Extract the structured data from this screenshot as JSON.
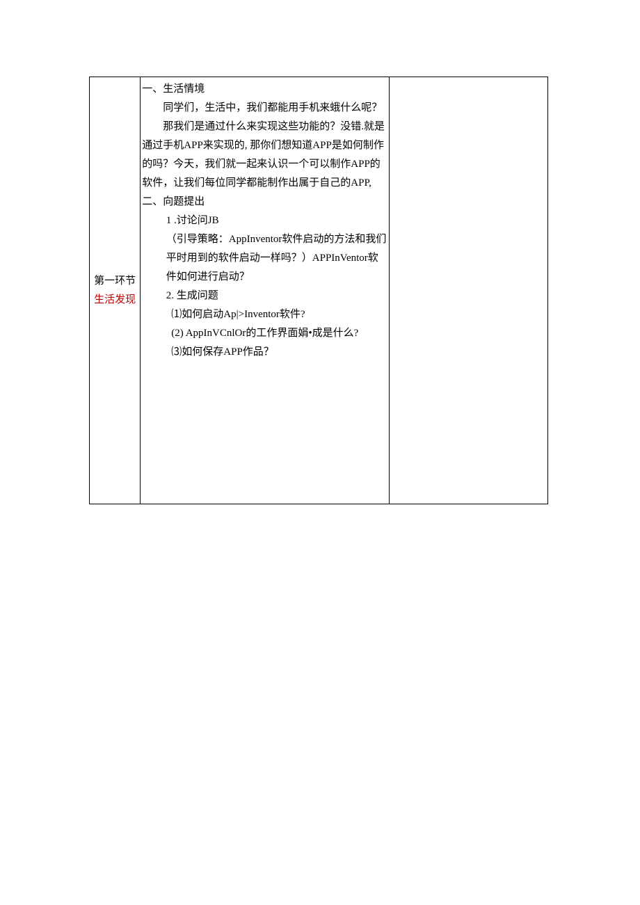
{
  "col1": {
    "line1": "第一环节",
    "line2": "生活发现"
  },
  "col2": {
    "h1": "一、生活情境",
    "p1": "同学们，生活中，我们都能用手机来蛾什么呢？",
    "p2": "那我们是通过什么来实现这些功能的？没错.就是通过手机APP来实现的, 那你们想知道APP是如何制作的吗？今天，我们就一起来认识一个可以制作APP的软件，让我们每位同学都能制作出属于自己的APP,二、向题提出",
    "s1": "1 .讨论问JB",
    "s1a": "（引导策略：AppInventor软件启动的方法和我们平时用到的软件启动一样吗？）APPInVentor软件如何进行启动？",
    "s2": "2. 生成问题",
    "q1": "⑴如何启动Ap|>Inventor软件?",
    "q2": "(2)  AppInVCnlOr的工作界面娟•成是什么?",
    "q3": "⑶如何保存APP作品？"
  }
}
